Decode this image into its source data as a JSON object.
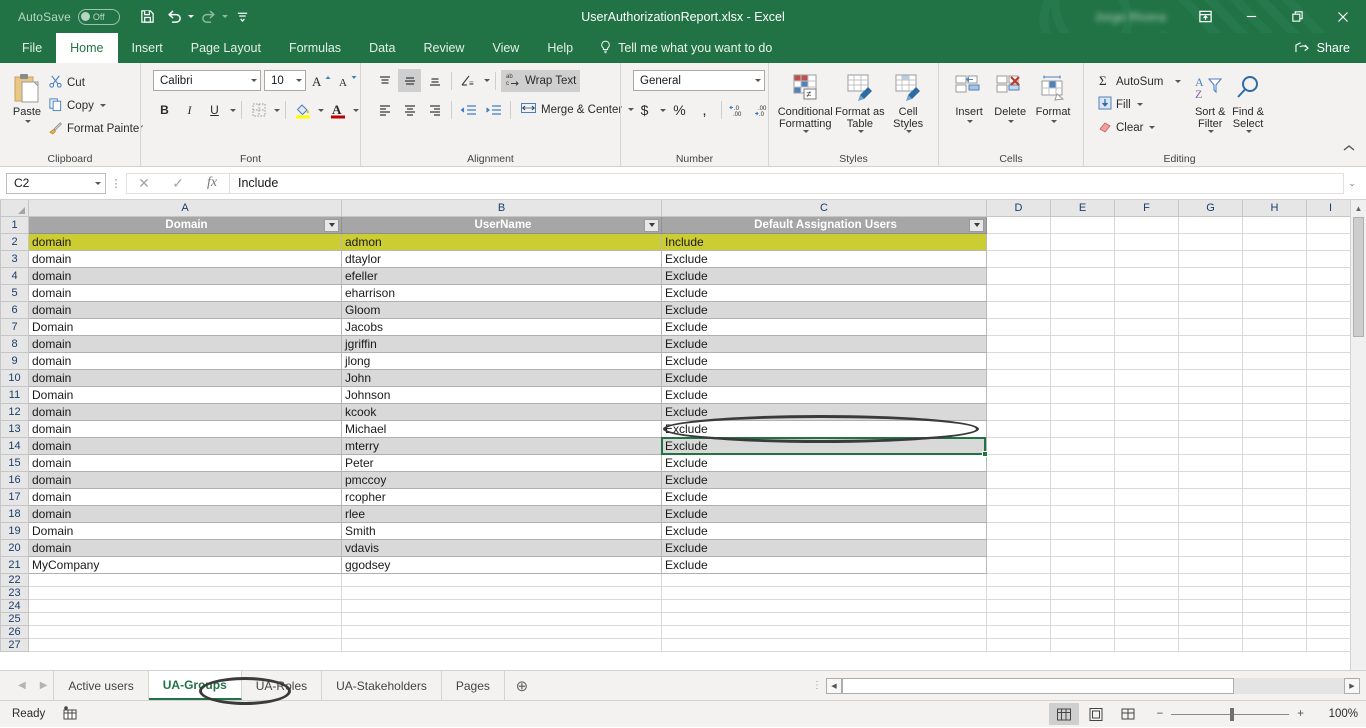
{
  "titlebar": {
    "autosave_label": "AutoSave",
    "autosave_state": "Off",
    "save_icon": "save-icon",
    "undo_icon": "undo-icon",
    "redo_icon": "redo-icon",
    "customize_icon": "customize-quick-access-icon",
    "document_title": "UserAuthorizationReport.xlsx  -  Excel",
    "user_name": "Jorge Rivera",
    "ribbon_display_icon": "ribbon-display-options-icon",
    "minimize_icon": "minimize-icon",
    "restore_icon": "restore-icon",
    "close_icon": "close-icon"
  },
  "ribbon": {
    "tabs": [
      {
        "label": "File",
        "active": false
      },
      {
        "label": "Home",
        "active": true
      },
      {
        "label": "Insert",
        "active": false
      },
      {
        "label": "Page Layout",
        "active": false
      },
      {
        "label": "Formulas",
        "active": false
      },
      {
        "label": "Data",
        "active": false
      },
      {
        "label": "Review",
        "active": false
      },
      {
        "label": "View",
        "active": false
      },
      {
        "label": "Help",
        "active": false
      }
    ],
    "tellme": "Tell me what you want to do",
    "share": "Share",
    "groups": {
      "clipboard": {
        "label": "Clipboard",
        "paste": "Paste",
        "cut": "Cut",
        "copy": "Copy",
        "format_painter": "Format Painter"
      },
      "font": {
        "label": "Font",
        "font_name": "Calibri",
        "font_size": "10",
        "grow_font": "A",
        "shrink_font": "A",
        "bold": "B",
        "italic": "I",
        "underline": "U",
        "fill_color": "A",
        "font_color": "A"
      },
      "alignment": {
        "label": "Alignment",
        "wrap_text": "Wrap Text",
        "merge_center": "Merge & Center"
      },
      "number": {
        "label": "Number",
        "format": "General",
        "currency": "$",
        "percent": "%",
        "comma": ",",
        "increase_decimal": ".00",
        "decrease_decimal": ".00"
      },
      "styles": {
        "label": "Styles",
        "conditional_formatting": "Conditional Formatting",
        "format_as_table": "Format as Table",
        "cell_styles": "Cell Styles"
      },
      "cells": {
        "label": "Cells",
        "insert": "Insert",
        "delete": "Delete",
        "format": "Format"
      },
      "editing": {
        "label": "Editing",
        "autosum": "AutoSum",
        "fill": "Fill",
        "clear": "Clear",
        "sort_filter": "Sort & Filter",
        "find_select": "Find & Select"
      }
    }
  },
  "formula_bar": {
    "name_box": "C2",
    "cancel_icon": "cancel-icon",
    "enter_icon": "confirm-icon",
    "function_icon": "insert-function-icon",
    "value": "Include"
  },
  "grid": {
    "column_headers": [
      "A",
      "B",
      "C",
      "D",
      "E",
      "F",
      "G",
      "H",
      "I"
    ],
    "table_headers": [
      "Domain",
      "UserName",
      "Default Assignation Users"
    ],
    "rows": [
      {
        "n": "2",
        "a": "domain",
        "b": "admon",
        "c": "Include"
      },
      {
        "n": "3",
        "a": "domain",
        "b": "dtaylor",
        "c": "Exclude"
      },
      {
        "n": "4",
        "a": "domain",
        "b": "efeller",
        "c": "Exclude"
      },
      {
        "n": "5",
        "a": "domain",
        "b": "eharrison",
        "c": "Exclude"
      },
      {
        "n": "6",
        "a": "domain",
        "b": "Gloom",
        "c": "Exclude"
      },
      {
        "n": "7",
        "a": "Domain",
        "b": "Jacobs",
        "c": "Exclude"
      },
      {
        "n": "8",
        "a": "domain",
        "b": "jgriffin",
        "c": "Exclude"
      },
      {
        "n": "9",
        "a": "domain",
        "b": "jlong",
        "c": "Exclude"
      },
      {
        "n": "10",
        "a": "domain",
        "b": "John",
        "c": "Exclude"
      },
      {
        "n": "11",
        "a": "Domain",
        "b": "Johnson",
        "c": "Exclude"
      },
      {
        "n": "12",
        "a": "domain",
        "b": "kcook",
        "c": "Exclude"
      },
      {
        "n": "13",
        "a": "domain",
        "b": "Michael",
        "c": "Exclude"
      },
      {
        "n": "14",
        "a": "domain",
        "b": "mterry",
        "c": "Exclude"
      },
      {
        "n": "15",
        "a": "domain",
        "b": "Peter",
        "c": "Exclude"
      },
      {
        "n": "16",
        "a": "domain",
        "b": "pmccoy",
        "c": "Exclude"
      },
      {
        "n": "17",
        "a": "domain",
        "b": "rcopher",
        "c": "Exclude"
      },
      {
        "n": "18",
        "a": "domain",
        "b": "rlee",
        "c": "Exclude"
      },
      {
        "n": "19",
        "a": "Domain",
        "b": "Smith",
        "c": "Exclude"
      },
      {
        "n": "20",
        "a": "domain",
        "b": "vdavis",
        "c": "Exclude"
      },
      {
        "n": "21",
        "a": "MyCompany",
        "b": "ggodsey",
        "c": "Exclude"
      }
    ],
    "header_row_number": "1",
    "empty_row_numbers": [
      "22",
      "23",
      "24",
      "25",
      "26",
      "27"
    ],
    "selected_cell": "C2",
    "annotation_target_header": "Default Assignation Users"
  },
  "sheet_tabs": {
    "prev_icon": "previous-sheet-icon",
    "next_icon": "next-sheet-icon",
    "tabs": [
      {
        "label": "Active users",
        "active": false
      },
      {
        "label": "UA-Groups",
        "active": true
      },
      {
        "label": "UA-Roles",
        "active": false
      },
      {
        "label": "UA-Stakeholders",
        "active": false
      },
      {
        "label": "Pages",
        "active": false
      }
    ],
    "add_sheet_icon": "add-sheet-icon"
  },
  "status_bar": {
    "status": "Ready",
    "accessibility_icon": "accessibility-checker-icon",
    "views": [
      {
        "name": "normal-view",
        "active": true
      },
      {
        "name": "page-layout-view",
        "active": false
      },
      {
        "name": "page-break-preview",
        "active": false
      }
    ],
    "zoom_out": "−",
    "zoom_in": "+",
    "zoom_level": "100%"
  },
  "colors": {
    "brand_green": "#217346",
    "selection_green": "#217346",
    "highlight_row": "#cccc33",
    "table_header_gray": "#a6a6a6",
    "band_gray": "#d9d9d9",
    "annotation": "#3a3a3a"
  }
}
